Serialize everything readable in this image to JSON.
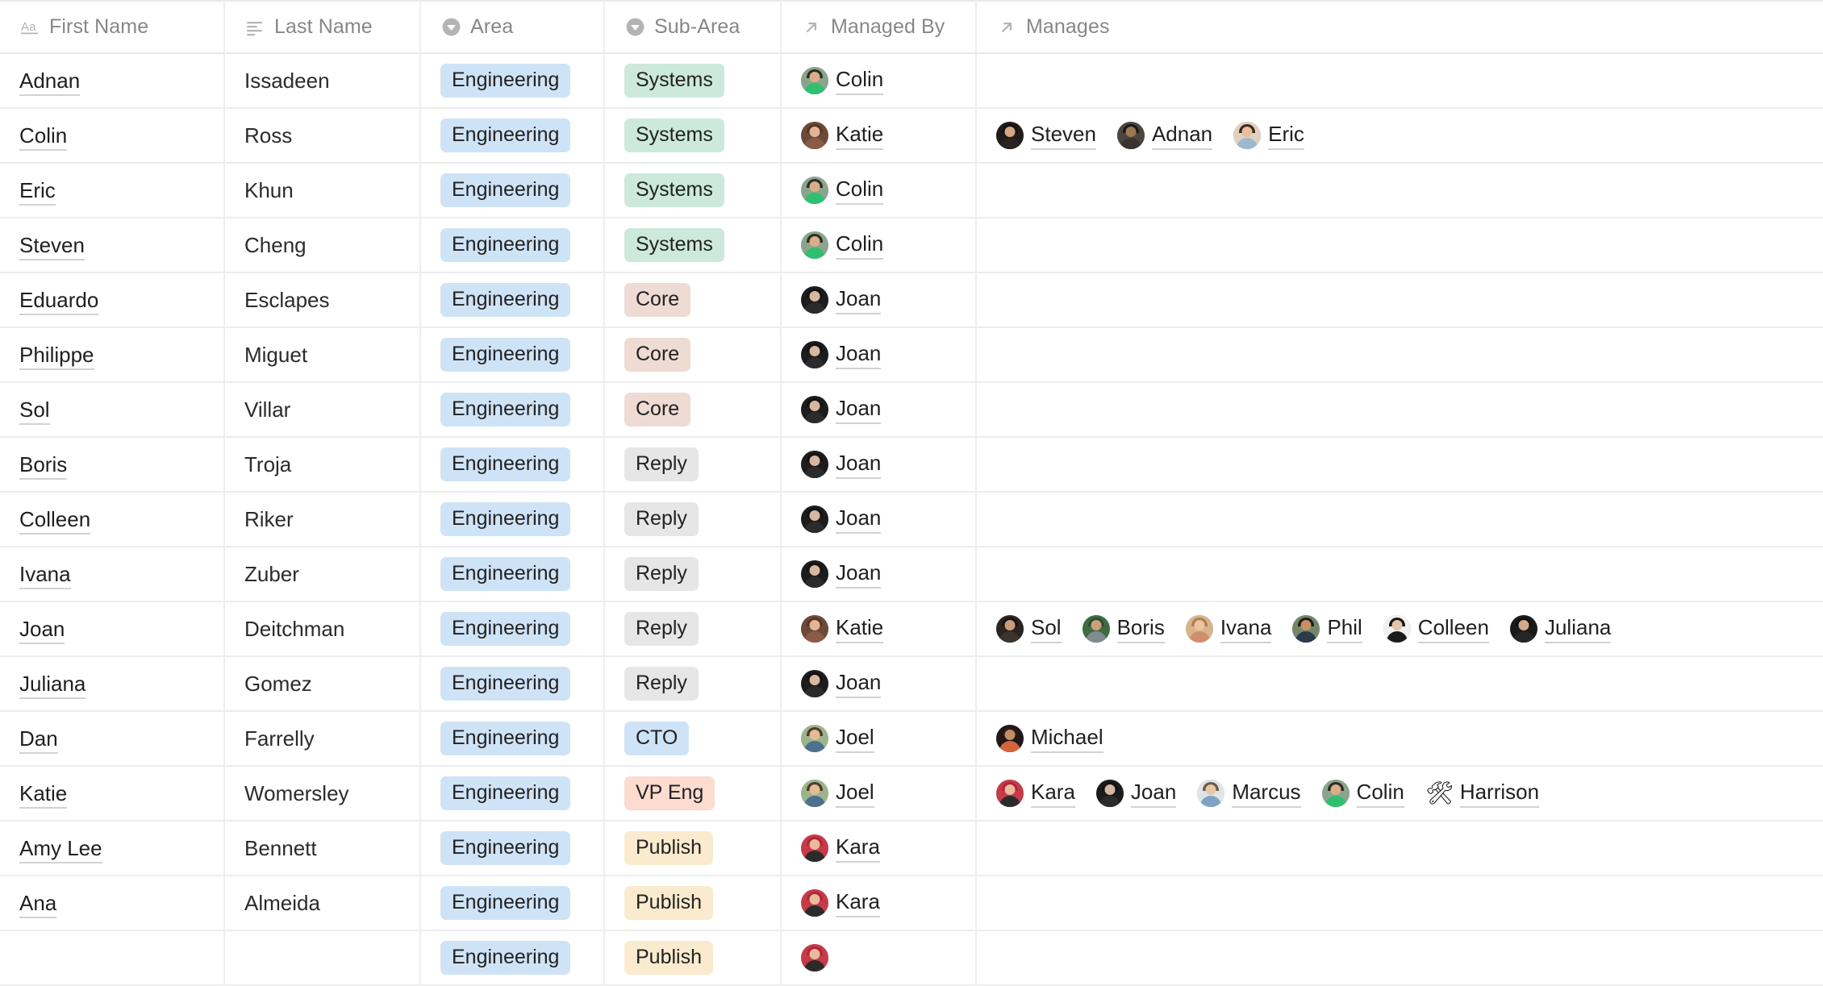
{
  "table": {
    "columns": [
      {
        "key": "first_name",
        "label": "First Name",
        "icon": "text-field-icon"
      },
      {
        "key": "last_name",
        "label": "Last Name",
        "icon": "long-text-icon"
      },
      {
        "key": "area",
        "label": "Area",
        "icon": "single-select-icon"
      },
      {
        "key": "sub_area",
        "label": "Sub-Area",
        "icon": "single-select-icon"
      },
      {
        "key": "managed_by",
        "label": "Managed By",
        "icon": "link-arrow-icon"
      },
      {
        "key": "manages",
        "label": "Manages",
        "icon": "link-arrow-icon"
      }
    ],
    "tag_colors": {
      "Engineering": "#cfe3f7",
      "Systems": "#cce9dc",
      "Core": "#eedbd4",
      "Reply": "#e6e6e6",
      "CTO": "#cfe3f7",
      "VP Eng": "#fbdccf",
      "Publish": "#fbebce"
    },
    "rows": [
      {
        "first_name": "Adnan",
        "last_name": "Issadeen",
        "area": "Engineering",
        "area_style": "tag-blue",
        "sub_area": "Systems",
        "sub_style": "tag-green",
        "managed_by": [
          {
            "name": "Colin",
            "avatar": "photo-colin"
          }
        ],
        "manages": []
      },
      {
        "first_name": "Colin",
        "last_name": "Ross",
        "area": "Engineering",
        "area_style": "tag-blue",
        "sub_area": "Systems",
        "sub_style": "tag-green",
        "managed_by": [
          {
            "name": "Katie",
            "avatar": "photo-katie"
          }
        ],
        "manages": [
          {
            "name": "Steven",
            "avatar": "photo-steven"
          },
          {
            "name": "Adnan",
            "avatar": "photo-adnan"
          },
          {
            "name": "Eric",
            "avatar": "photo-eric"
          }
        ]
      },
      {
        "first_name": "Eric",
        "last_name": "Khun",
        "area": "Engineering",
        "area_style": "tag-blue",
        "sub_area": "Systems",
        "sub_style": "tag-green",
        "managed_by": [
          {
            "name": "Colin",
            "avatar": "photo-colin"
          }
        ],
        "manages": []
      },
      {
        "first_name": "Steven",
        "last_name": "Cheng",
        "area": "Engineering",
        "area_style": "tag-blue",
        "sub_area": "Systems",
        "sub_style": "tag-green",
        "managed_by": [
          {
            "name": "Colin",
            "avatar": "photo-colin"
          }
        ],
        "manages": []
      },
      {
        "first_name": "Eduardo",
        "last_name": "Esclapes",
        "area": "Engineering",
        "area_style": "tag-blue",
        "sub_area": "Core",
        "sub_style": "tag-rose",
        "managed_by": [
          {
            "name": "Joan",
            "avatar": "photo-joan"
          }
        ],
        "manages": []
      },
      {
        "first_name": "Philippe",
        "last_name": "Miguet",
        "area": "Engineering",
        "area_style": "tag-blue",
        "sub_area": "Core",
        "sub_style": "tag-rose",
        "managed_by": [
          {
            "name": "Joan",
            "avatar": "photo-joan"
          }
        ],
        "manages": []
      },
      {
        "first_name": "Sol",
        "last_name": "Villar",
        "area": "Engineering",
        "area_style": "tag-blue",
        "sub_area": "Core",
        "sub_style": "tag-rose",
        "managed_by": [
          {
            "name": "Joan",
            "avatar": "photo-joan"
          }
        ],
        "manages": []
      },
      {
        "first_name": "Boris",
        "last_name": "Troja",
        "area": "Engineering",
        "area_style": "tag-blue",
        "sub_area": "Reply",
        "sub_style": "tag-gray",
        "managed_by": [
          {
            "name": "Joan",
            "avatar": "photo-joan"
          }
        ],
        "manages": []
      },
      {
        "first_name": "Colleen",
        "last_name": "Riker",
        "area": "Engineering",
        "area_style": "tag-blue",
        "sub_area": "Reply",
        "sub_style": "tag-gray",
        "managed_by": [
          {
            "name": "Joan",
            "avatar": "photo-joan"
          }
        ],
        "manages": []
      },
      {
        "first_name": "Ivana",
        "last_name": "Zuber",
        "area": "Engineering",
        "area_style": "tag-blue",
        "sub_area": "Reply",
        "sub_style": "tag-gray",
        "managed_by": [
          {
            "name": "Joan",
            "avatar": "photo-joan"
          }
        ],
        "manages": []
      },
      {
        "first_name": "Joan",
        "last_name": "Deitchman",
        "area": "Engineering",
        "area_style": "tag-blue",
        "sub_area": "Reply",
        "sub_style": "tag-gray",
        "managed_by": [
          {
            "name": "Katie",
            "avatar": "photo-katie"
          }
        ],
        "manages": [
          {
            "name": "Sol",
            "avatar": "photo-sol"
          },
          {
            "name": "Boris",
            "avatar": "photo-boris"
          },
          {
            "name": "Ivana",
            "avatar": "photo-ivana"
          },
          {
            "name": "Phil",
            "avatar": "photo-phil"
          },
          {
            "name": "Colleen",
            "avatar": "photo-colleen"
          },
          {
            "name": "Juliana",
            "avatar": "photo-juliana"
          }
        ]
      },
      {
        "first_name": "Juliana",
        "last_name": "Gomez",
        "area": "Engineering",
        "area_style": "tag-blue",
        "sub_area": "Reply",
        "sub_style": "tag-gray",
        "managed_by": [
          {
            "name": "Joan",
            "avatar": "photo-joan"
          }
        ],
        "manages": []
      },
      {
        "first_name": "Dan",
        "last_name": "Farrelly",
        "area": "Engineering",
        "area_style": "tag-blue",
        "sub_area": "CTO",
        "sub_style": "tag-lblue",
        "managed_by": [
          {
            "name": "Joel",
            "avatar": "photo-joel"
          }
        ],
        "manages": [
          {
            "name": "Michael",
            "avatar": "photo-michael"
          }
        ]
      },
      {
        "first_name": "Katie",
        "last_name": "Womersley",
        "area": "Engineering",
        "area_style": "tag-blue",
        "sub_area": "VP Eng",
        "sub_style": "tag-peach",
        "managed_by": [
          {
            "name": "Joel",
            "avatar": "photo-joel"
          }
        ],
        "manages": [
          {
            "name": "Kara",
            "avatar": "photo-kara"
          },
          {
            "name": "Joan",
            "avatar": "photo-joan"
          },
          {
            "name": "Marcus",
            "avatar": "photo-marcus"
          },
          {
            "name": "Colin",
            "avatar": "photo-colin"
          },
          {
            "name": "Harrison",
            "avatar": "emoji-hammer-and-wrench",
            "emoji": "🛠"
          }
        ]
      },
      {
        "first_name": "Amy Lee",
        "last_name": "Bennett",
        "area": "Engineering",
        "area_style": "tag-blue",
        "sub_area": "Publish",
        "sub_style": "tag-cream",
        "managed_by": [
          {
            "name": "Kara",
            "avatar": "photo-kara"
          }
        ],
        "manages": []
      },
      {
        "first_name": "Ana",
        "last_name": "Almeida",
        "area": "Engineering",
        "area_style": "tag-blue",
        "sub_area": "Publish",
        "sub_style": "tag-cream",
        "managed_by": [
          {
            "name": "Kara",
            "avatar": "photo-kara"
          }
        ],
        "manages": []
      },
      {
        "first_name": "",
        "last_name": "",
        "area": "Engineering",
        "area_style": "tag-blue",
        "sub_area": "Publish",
        "sub_style": "tag-cream",
        "managed_by": [
          {
            "name": "",
            "avatar": "photo-kara"
          }
        ],
        "manages": [],
        "partial": true
      }
    ]
  },
  "avatar_palette": {
    "photo-colin": {
      "bg": "#8aa58c",
      "skin": "#d9ae8a",
      "hair": "#2e2a26",
      "body": "#2fbf6f"
    },
    "photo-katie": {
      "bg": "#6b4a3a",
      "skin": "#e3b596",
      "hair": "#5a3520",
      "body": "#8c5b46"
    },
    "photo-steven": {
      "bg": "#201c1a",
      "skin": "#d8a684",
      "hair": "#161312",
      "body": "#2a2320"
    },
    "photo-adnan": {
      "bg": "#4a453f",
      "skin": "#9c7755",
      "hair": "#1d1814",
      "body": "#3a3430"
    },
    "photo-eric": {
      "bg": "#dfd0c0",
      "skin": "#e8bf9d",
      "hair": "#3b2a1c",
      "body": "#9fb7cf"
    },
    "photo-joan": {
      "bg": "#1c1c1c",
      "skin": "#d8b7a0",
      "hair": "#121212",
      "body": "#2b2b2b"
    },
    "photo-sol": {
      "bg": "#2a2522",
      "skin": "#c99c7c",
      "hair": "#19130f",
      "body": "#3c332d"
    },
    "photo-boris": {
      "bg": "#3f6b42",
      "skin": "#cf9f7c",
      "hair": "#2a5130",
      "body": "#7e8b8f"
    },
    "photo-ivana": {
      "bg": "#d7b48e",
      "skin": "#ecc3a2",
      "hair": "#b07f49",
      "body": "#cf8f6b"
    },
    "photo-phil": {
      "bg": "#73886a",
      "skin": "#c88f67",
      "hair": "#231a14",
      "body": "#2c3a4c"
    },
    "photo-colleen": {
      "bg": "#f0f0f0",
      "skin": "#e4c3ab",
      "hair": "#141414",
      "body": "#1b1b1b"
    },
    "photo-juliana": {
      "bg": "#1a1a1a",
      "skin": "#d4a98c",
      "hair": "#0e0e0e",
      "body": "#262626"
    },
    "photo-joel": {
      "bg": "#9bb48c",
      "skin": "#e4bb97",
      "hair": "#4b3a28",
      "body": "#4f6f8f"
    },
    "photo-michael": {
      "bg": "#20181a",
      "skin": "#c58d62",
      "hair": "#2a1c18",
      "body": "#d4643c"
    },
    "photo-kara": {
      "bg": "#c73a4a",
      "skin": "#e8bb9c",
      "hair": "#b02736",
      "body": "#2b2b2b"
    },
    "photo-marcus": {
      "bg": "#dfe4e8",
      "skin": "#e8c6a8",
      "hair": "#6d5a45",
      "body": "#7fa3c4"
    }
  }
}
